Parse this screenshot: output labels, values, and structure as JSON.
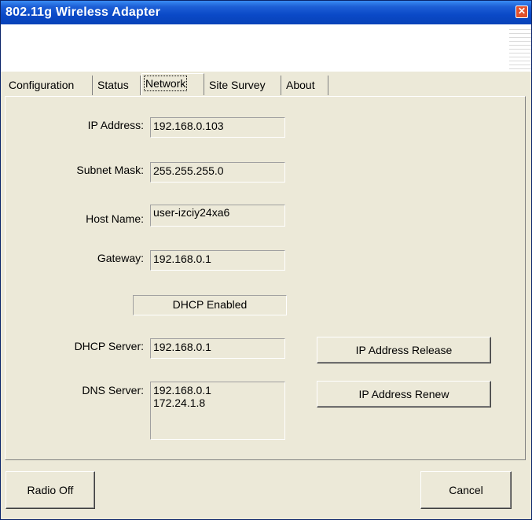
{
  "window": {
    "title": "802.11g Wireless Adapter",
    "close_glyph": "✕"
  },
  "tabs": [
    {
      "label": "Configuration"
    },
    {
      "label": "Status"
    },
    {
      "label": "Network"
    },
    {
      "label": "Site Survey"
    },
    {
      "label": "About"
    }
  ],
  "active_tab": "Network",
  "network": {
    "ip_address": {
      "label": "IP Address:",
      "value": "192.168.0.103"
    },
    "subnet_mask": {
      "label": "Subnet Mask:",
      "value": "255.255.255.0"
    },
    "host_name": {
      "label": "Host Name:",
      "value": "user-izciy24xa6"
    },
    "gateway": {
      "label": "Gateway:",
      "value": "192.168.0.1"
    },
    "dhcp_status": "DHCP Enabled",
    "dhcp_server": {
      "label": "DHCP Server:",
      "value": "192.168.0.1"
    },
    "dns_server": {
      "label": "DNS Server:",
      "values": [
        "192.168.0.1",
        "172.24.1.8"
      ]
    },
    "release_button": "IP Address Release",
    "renew_button": "IP Address Renew"
  },
  "footer": {
    "radio_off_button": "Radio Off",
    "cancel_button": "Cancel"
  },
  "colors": {
    "title_bar": "#0a49c7",
    "face": "#ece9d8",
    "close_button": "#e1502b"
  }
}
